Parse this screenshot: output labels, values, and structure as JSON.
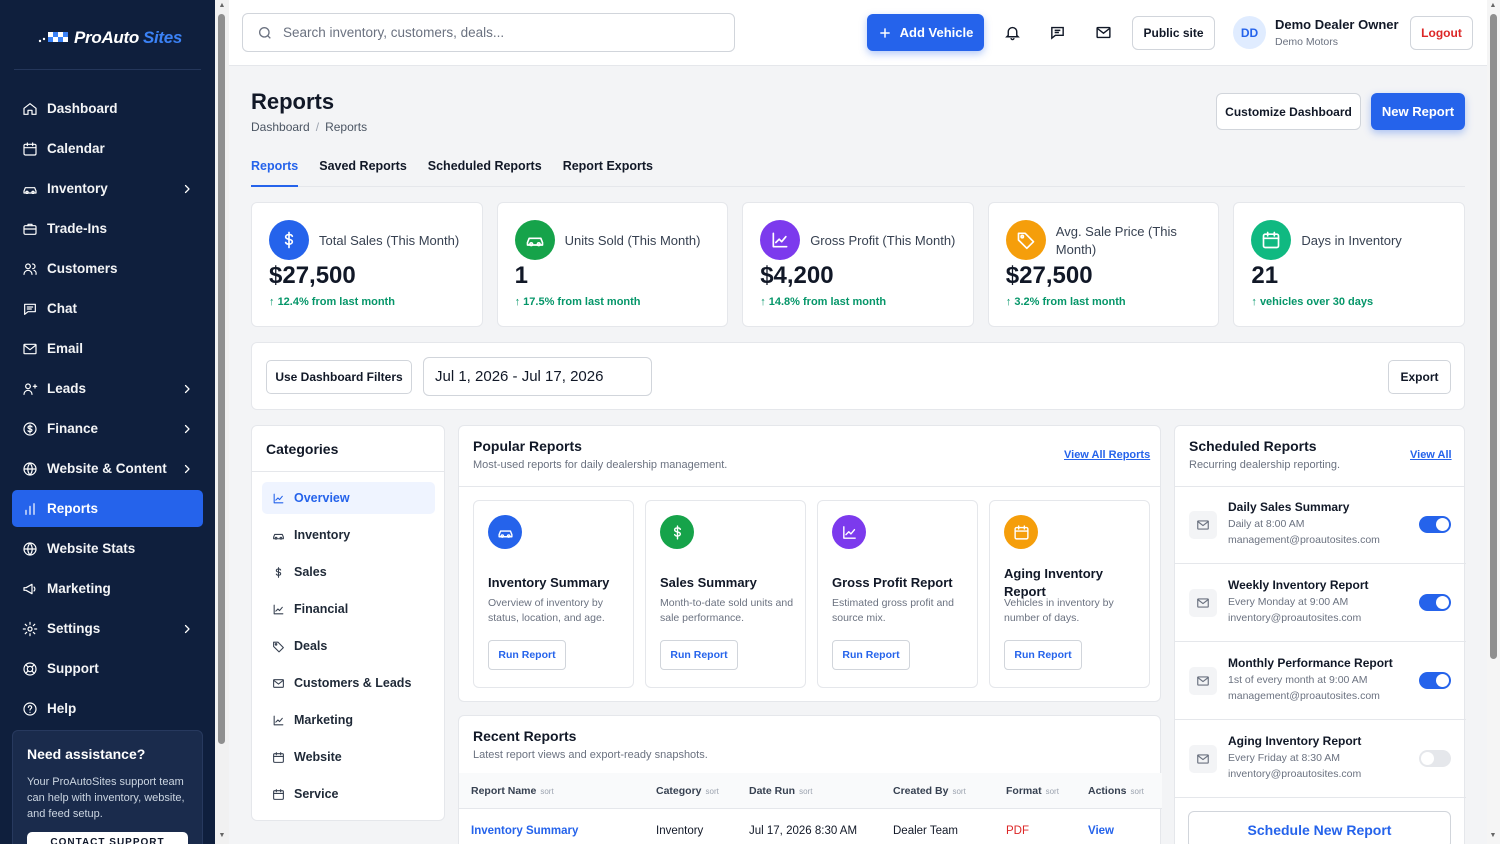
{
  "brand": {
    "name_part1": "ProAuto",
    "name_part2": "Sites"
  },
  "sidebar": {
    "items": [
      {
        "label": "Dashboard",
        "icon": "home-icon"
      },
      {
        "label": "Calendar",
        "icon": "calendar-icon"
      },
      {
        "label": "Inventory",
        "icon": "car-icon",
        "has_children": true
      },
      {
        "label": "Trade-Ins",
        "icon": "briefcase-icon"
      },
      {
        "label": "Customers",
        "icon": "users-icon"
      },
      {
        "label": "Chat",
        "icon": "chat-icon"
      },
      {
        "label": "Email",
        "icon": "mail-icon"
      },
      {
        "label": "Leads",
        "icon": "leads-icon",
        "has_children": true
      },
      {
        "label": "Finance",
        "icon": "dollar-circle-icon",
        "has_children": true
      },
      {
        "label": "Website & Content",
        "icon": "globe-icon",
        "has_children": true
      },
      {
        "label": "Reports",
        "icon": "bar-chart-icon",
        "active": true
      },
      {
        "label": "Website Stats",
        "icon": "globe-icon"
      },
      {
        "label": "Marketing",
        "icon": "megaphone-icon"
      },
      {
        "label": "Settings",
        "icon": "gear-icon",
        "has_children": true
      },
      {
        "label": "Support",
        "icon": "lifebuoy-icon"
      },
      {
        "label": "Help",
        "icon": "help-icon"
      }
    ],
    "assist": {
      "title": "Need assistance?",
      "text": "Your ProAutoSites support team can help with inventory, website, and feed setup.",
      "button": "CONTACT SUPPORT"
    }
  },
  "topbar": {
    "search_placeholder": "Search inventory, customers, deals...",
    "add_vehicle": "Add Vehicle",
    "public_site": "Public site",
    "user_initials": "DD",
    "user_name": "Demo Dealer Owner",
    "dealership": "Demo Motors",
    "logout": "Logout"
  },
  "page": {
    "title": "Reports",
    "breadcrumb": [
      "Dashboard",
      "Reports"
    ],
    "customize_button": "Customize Dashboard",
    "new_report_button": "New Report",
    "tabs": [
      "Reports",
      "Saved Reports",
      "Scheduled Reports",
      "Report Exports"
    ],
    "active_tab": "Reports"
  },
  "kpis": [
    {
      "label": "Total Sales (This Month)",
      "value": "$27,500",
      "delta": "12.4% from last month",
      "icon": "dollar-icon",
      "color": "#2563eb"
    },
    {
      "label": "Units Sold (This Month)",
      "value": "1",
      "delta": "17.5% from last month",
      "icon": "car-icon",
      "color": "#16a34a"
    },
    {
      "label": "Gross Profit (This Month)",
      "value": "$4,200",
      "delta": "14.8% from last month",
      "icon": "chart-line-icon",
      "color": "#7c3aed"
    },
    {
      "label": "Avg. Sale Price (This Month)",
      "value": "$27,500",
      "delta": "3.2% from last month",
      "icon": "tag-icon",
      "color": "#f59e0b"
    },
    {
      "label": "Days in Inventory",
      "value": "21",
      "delta": "vehicles over 30 days",
      "icon": "calendar-icon",
      "color": "#10b981"
    }
  ],
  "filters": {
    "use_dashboard": "Use Dashboard Filters",
    "date_range": "Jul 1, 2026 - Jul 17, 2026",
    "export": "Export"
  },
  "categories": {
    "title": "Categories",
    "items": [
      {
        "label": "Overview",
        "icon": "chart-line-icon",
        "active": true
      },
      {
        "label": "Inventory",
        "icon": "car-icon"
      },
      {
        "label": "Sales",
        "icon": "dollar-icon"
      },
      {
        "label": "Financial",
        "icon": "chart-line-icon"
      },
      {
        "label": "Deals",
        "icon": "tag-icon"
      },
      {
        "label": "Customers & Leads",
        "icon": "mail-icon"
      },
      {
        "label": "Marketing",
        "icon": "chart-line-icon"
      },
      {
        "label": "Website",
        "icon": "calendar-icon"
      },
      {
        "label": "Service",
        "icon": "calendar-icon"
      }
    ]
  },
  "popular": {
    "title": "Popular Reports",
    "subtitle": "Most-used reports for daily dealership management.",
    "view_all": "View All Reports",
    "reports": [
      {
        "name": "Inventory Summary",
        "desc": "Overview of inventory by status, location, and age.",
        "button": "Run Report",
        "icon": "car-icon",
        "color": "#2563eb"
      },
      {
        "name": "Sales Summary",
        "desc": "Month-to-date sold units and sale performance.",
        "button": "Run Report",
        "icon": "dollar-icon",
        "color": "#16a34a"
      },
      {
        "name": "Gross Profit Report",
        "desc": "Estimated gross profit and source mix.",
        "button": "Run Report",
        "icon": "chart-line-icon",
        "color": "#7c3aed"
      },
      {
        "name": "Aging Inventory Report",
        "desc": "Vehicles in inventory by number of days.",
        "button": "Run Report",
        "icon": "calendar-icon",
        "color": "#f59e0b"
      }
    ]
  },
  "recent": {
    "title": "Recent Reports",
    "subtitle": "Latest report views and export-ready snapshots.",
    "columns": [
      "Report Name",
      "Category",
      "Date Run",
      "Created By",
      "Format",
      "Actions"
    ],
    "sort_label": "sort",
    "rows": [
      {
        "name": "Inventory Summary",
        "category": "Inventory",
        "date": "Jul 17, 2026 8:30 AM",
        "created_by": "Dealer Team",
        "format": "PDF",
        "action": "View"
      }
    ]
  },
  "scheduled": {
    "title": "Scheduled Reports",
    "subtitle": "Recurring dealership reporting.",
    "view_all": "View All",
    "items": [
      {
        "name": "Daily Sales Summary",
        "when": "Daily at 8:00 AM",
        "email": "management@proautosites.com",
        "enabled": true
      },
      {
        "name": "Weekly Inventory Report",
        "when": "Every Monday at 9:00 AM",
        "email": "inventory@proautosites.com",
        "enabled": true
      },
      {
        "name": "Monthly Performance Report",
        "when": "1st of every month at 9:00 AM",
        "email": "management@proautosites.com",
        "enabled": true
      },
      {
        "name": "Aging Inventory Report",
        "when": "Every Friday at 8:30 AM",
        "email": "inventory@proautosites.com",
        "enabled": false
      }
    ],
    "button": "Schedule New Report"
  },
  "colors": {
    "sidebar_bg": "#0f1f3d",
    "accent": "#2563eb",
    "positive": "#059669",
    "danger": "#dc2626"
  }
}
